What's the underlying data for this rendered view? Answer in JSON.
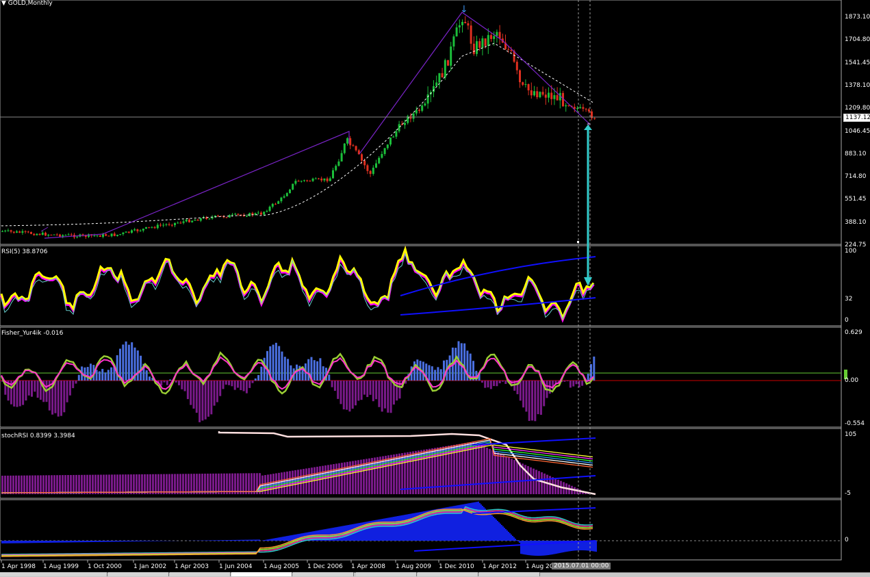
{
  "window": {
    "title": "GOLD,Monthly"
  },
  "colors": {
    "background": "#000000",
    "bull": "#1bbf3a",
    "bear": "#e03020",
    "trendline": "#7a24c8",
    "trendline_blue": "#1010ff",
    "rsi_main": "#ffff00",
    "rsi_under": "#ff00ff",
    "fisher_pos": "#4a6fe0",
    "fisher_neg": "#7a1a8a",
    "fisher_line1": "#99cc33",
    "fisher_line2": "#ff33cc",
    "arrow": "#33cccc",
    "hist_blue": "#1020e0",
    "stoch_hist": "#7a1a8a",
    "stoch_white": "#ffe0e0"
  },
  "price_axis": [
    "1873.10",
    "1704.80",
    "1541.45",
    "1378.10",
    "1209.80",
    "1046.45",
    "883.10",
    "714.80",
    "551.45",
    "388.10",
    "224.75"
  ],
  "current_price": "1137.12",
  "time_axis": [
    "1 Apr 1998",
    "1 Aug 1999",
    "1 Oct 2000",
    "1 Jan 2002",
    "1 Apr 2003",
    "1 Jun 2004",
    "1 Aug 2005",
    "1 Dec 2006",
    "1 Apr 2008",
    "1 Aug 2009",
    "1 Dec 2010",
    "1 Apr 2012",
    "1 Aug 20"
  ],
  "cursor_time": "2015.07.01 00:00",
  "panels": {
    "rsi": {
      "label": "RSI(5) 38.8706",
      "levels": [
        "100",
        "32",
        "0"
      ]
    },
    "fisher": {
      "label": "Fisher_Yur4ik -0.016",
      "levels": [
        "0.629",
        "0.00",
        "-0.554"
      ]
    },
    "stoch": {
      "label": "stochRSI 0.8399 3.3984",
      "levels": [
        "105",
        "-5"
      ]
    },
    "hist": {
      "label": "",
      "levels": [
        "0"
      ]
    }
  },
  "tabs": [
    "",
    "",
    "",
    "",
    "",
    "",
    "",
    "",
    ""
  ]
}
